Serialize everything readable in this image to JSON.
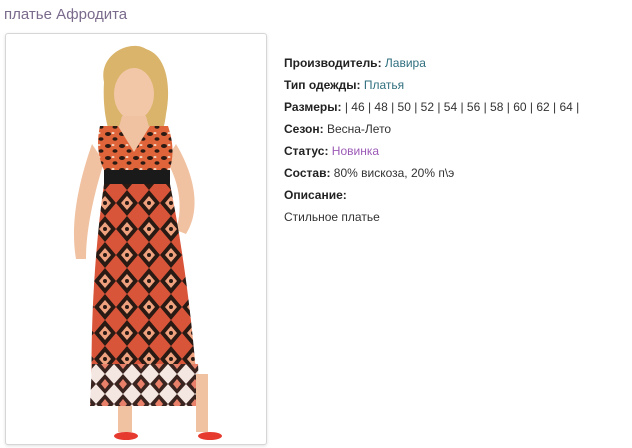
{
  "page": {
    "title": "платье Афродита"
  },
  "product": {
    "image_alt": "woman wearing a long orange and black patterned dress",
    "fields": {
      "manufacturer_label": "Производитель:",
      "manufacturer_value": "Лавира",
      "clothing_type_label": "Тип одежды:",
      "clothing_type_value": "Платья",
      "sizes_label": "Размеры:",
      "sizes_value": "| 46 | 48 | 50 | 52 | 54 | 56 | 58 | 60 | 62 | 64 |",
      "season_label": "Сезон:",
      "season_value": "Весна-Лето",
      "status_label": "Статус:",
      "status_value": "Новинка",
      "composition_label": "Состав:",
      "composition_value": "80% вискоза, 20% п\\э",
      "description_label": "Описание:",
      "description_value": "Стильное платье"
    }
  },
  "colors": {
    "title": "#7a6a8c",
    "link": "#2f6f7e",
    "status": "#9b59b6",
    "dress_primary": "#e0643a",
    "dress_dark": "#2a1a14"
  }
}
